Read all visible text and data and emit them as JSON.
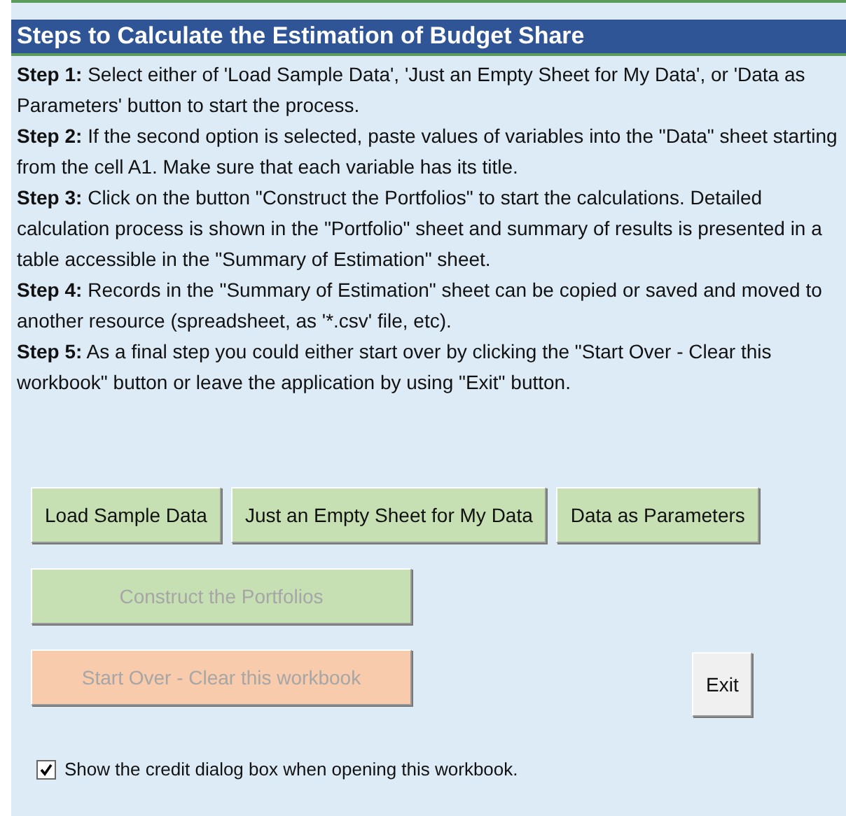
{
  "title": "Steps to Calculate the Estimation of Budget Share",
  "steps": [
    "**Step 1:** Select either of 'Load Sample Data', 'Just an Empty Sheet for My Data', or 'Data as Parameters' button to start the process.",
    "**Step 2:** If the second option is selected, paste values of variables into the \"Data\" sheet starting from the cell A1. Make sure that each variable has its title.",
    "**Step 3:** Click on the button \"Construct the Portfolios\" to start the calculations. Detailed calculation process is shown in the \"Portfolio\" sheet and summary of results is presented in a table accessible in the \"Summary of Estimation\" sheet.",
    "**Step 4:** Records in the \"Summary of Estimation\" sheet can be copied or saved and moved to another resource (spreadsheet, as '*.csv' file, etc).",
    "**Step 5:** As a final step you could either start over by clicking the \"Start Over - Clear this workbook\" button or leave the application by using \"Exit\" button."
  ],
  "button_rows": [
    {
      "buttons": [
        {
          "label": "Load Sample Data",
          "kind": "green",
          "disabled": false
        },
        {
          "label": "Just an Empty Sheet for My Data",
          "kind": "green",
          "disabled": false
        },
        {
          "label": "Data as Parameters",
          "kind": "green",
          "disabled": false
        }
      ]
    },
    {
      "buttons": [
        {
          "label": "Construct the Portfolios",
          "kind": "green",
          "disabled": true
        }
      ]
    },
    {
      "buttons": [
        {
          "label": "Start Over - Clear this workbook",
          "kind": "orange",
          "disabled": true
        },
        {
          "label": "Exit",
          "kind": "plain",
          "disabled": false
        }
      ]
    }
  ],
  "checkbox": {
    "label": "Show the credit dialog box when opening this workbook.",
    "checked": true
  }
}
